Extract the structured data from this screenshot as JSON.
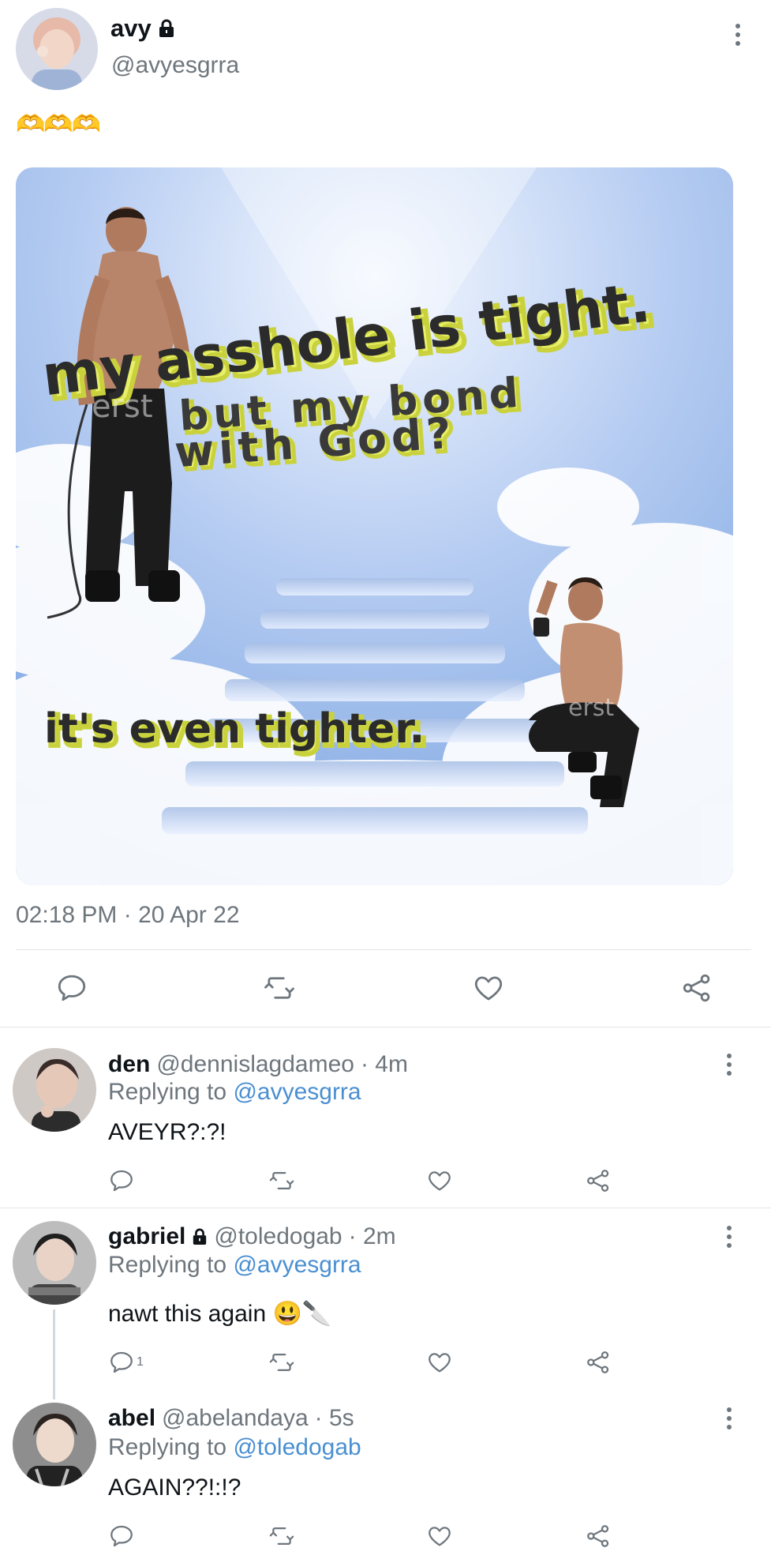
{
  "tweet": {
    "display_name": "avy",
    "handle": "@avyesgrra",
    "body_emoji": "🫶🫶🫶",
    "meme": {
      "line1": "my asshole is tight.",
      "line2a": "but my bond",
      "line2b": "with God?",
      "line3": "it's even tighter.",
      "watermark": "erst"
    },
    "timestamp": "02:18 PM · 20 Apr 22"
  },
  "replies": [
    {
      "display_name": "den",
      "handle": "@dennislagdameo",
      "time": "· 4m",
      "replying_prefix": "Replying to",
      "replying_to": "@avyesgrra",
      "text": "AVEYR?:?!",
      "reply_count": ""
    },
    {
      "display_name": "gabriel",
      "handle": "@toledogab",
      "time": "· 2m",
      "replying_prefix": "Replying to",
      "replying_to": "@avyesgrra",
      "text": "nawt this again 😃🔪",
      "reply_count": "1"
    },
    {
      "display_name": "abel",
      "handle": "@abelandaya",
      "time": "· 5s",
      "replying_prefix": "Replying to",
      "replying_to": "@toledogab",
      "text": "AGAIN??!:!?",
      "reply_count": ""
    }
  ],
  "colors": {
    "link": "#4a8fd1",
    "muted": "#6e767d",
    "meme_text_face": "#2b2b2b",
    "meme_text_extrude": "#e8ef6a"
  },
  "icons": [
    "lock-icon",
    "more-icon",
    "reply-icon",
    "retweet-icon",
    "like-icon",
    "share-icon"
  ]
}
